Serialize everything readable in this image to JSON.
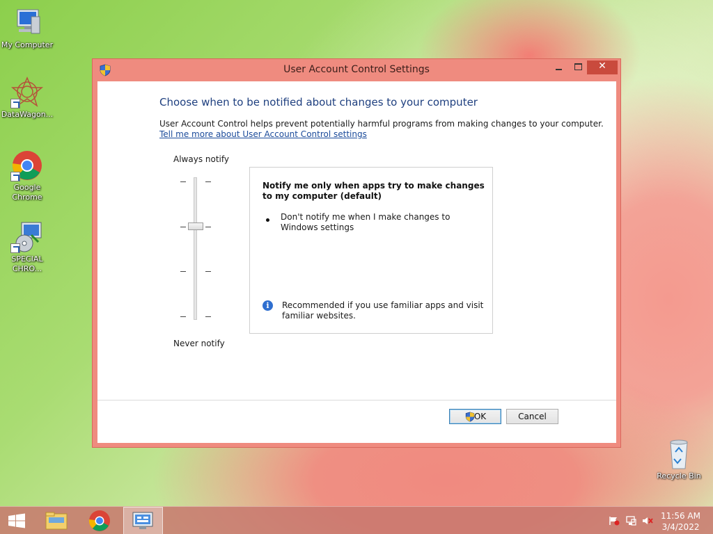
{
  "desktop": {
    "icons": [
      {
        "label": "My Computer",
        "icon": "computer-icon"
      },
      {
        "label": "DataWagon...",
        "icon": "datawagon-icon"
      },
      {
        "label": "Google Chrome",
        "icon": "chrome-icon"
      },
      {
        "label": "SPECIAL CHRO...",
        "icon": "installer-icon"
      },
      {
        "label": "Recycle Bin",
        "icon": "recycle-bin-icon"
      }
    ]
  },
  "window": {
    "title": "User Account Control Settings",
    "close_glyph": "✕",
    "heading": "Choose when to be notified about changes to your computer",
    "description": "User Account Control helps prevent potentially harmful programs from making changes to your computer.",
    "learn_more": "Tell me more about User Account Control settings",
    "slider": {
      "top_label": "Always notify",
      "bottom_label": "Never notify",
      "levels": 4,
      "selected_level": 3
    },
    "info": {
      "title": "Notify me only when apps try to make changes to my computer (default)",
      "bullet": "Don't notify me when I make changes to Windows settings",
      "info_glyph": "i",
      "recommendation": "Recommended if you use familiar apps and visit familiar websites."
    },
    "buttons": {
      "ok": "OK",
      "cancel": "Cancel"
    }
  },
  "taskbar": {
    "clock_time": "11:56 AM",
    "clock_date": "3/4/2022"
  },
  "colors": {
    "window_frame": "#ef8b7f",
    "heading": "#1e3f7f",
    "link": "#1a4a9a",
    "close_button": "#c94a3d"
  }
}
